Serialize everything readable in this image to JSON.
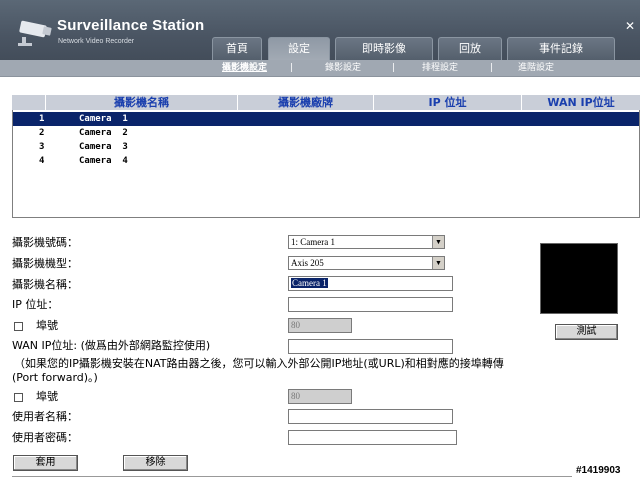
{
  "header": {
    "title": "Surveillance Station",
    "subtitle": "Network Video Recorder",
    "tabs": [
      {
        "label": "首頁"
      },
      {
        "label": "設定"
      },
      {
        "label": "即時影像"
      },
      {
        "label": "回放"
      },
      {
        "label": "事件記錄"
      }
    ],
    "active_tab": "設定"
  },
  "subnav": {
    "items": [
      {
        "label": "攝影機設定"
      },
      {
        "label": "錄影設定"
      },
      {
        "label": "排程設定"
      },
      {
        "label": "進階設定"
      }
    ],
    "separator": "|"
  },
  "camera_table": {
    "columns": [
      "攝影機名稱",
      "攝影機廠牌",
      "IP 位址",
      "WAN IP位址"
    ],
    "rows": [
      {
        "num": "1",
        "name": "Camera  1"
      },
      {
        "num": "2",
        "name": "Camera  2"
      },
      {
        "num": "3",
        "name": "Camera  3"
      },
      {
        "num": "4",
        "name": "Camera  4"
      }
    ]
  },
  "form": {
    "camera_number_label": "攝影機號碼：",
    "camera_number_value": "1: Camera 1",
    "camera_model_label": "攝影機機型：",
    "camera_model_value": "Axis 205",
    "camera_name_label": "攝影機名稱：",
    "camera_name_value": "Camera 1",
    "ip_label": "IP 位址：",
    "ip_value": "",
    "port_label": "埠號",
    "port_value": "80",
    "wan_ip_label": "WAN IP位址: (做爲由外部網路監控使用)",
    "wan_ip_value": "",
    "note_line1": "（如果您的IP攝影機安裝在NAT路由器之後，您可以輸入外部公開IP地址(或URL)和相對應的接埠轉傳",
    "note_line2": "(Port forward)。)",
    "wan_port_label": "埠號",
    "wan_port_value": "80",
    "username_label": "使用者名稱：",
    "username_value": "",
    "password_label": "使用者密碼：",
    "password_value": "",
    "test_button": "測試",
    "apply_button": "套用",
    "remove_button": "移除"
  },
  "watermark": "#1419903",
  "colors": {
    "header_bg": "#4a5563",
    "subnav_bg": "#a0a8b2",
    "table_header_bg": "#c9ced8",
    "table_header_text": "#1a3fae",
    "selection": "#0a246a"
  }
}
